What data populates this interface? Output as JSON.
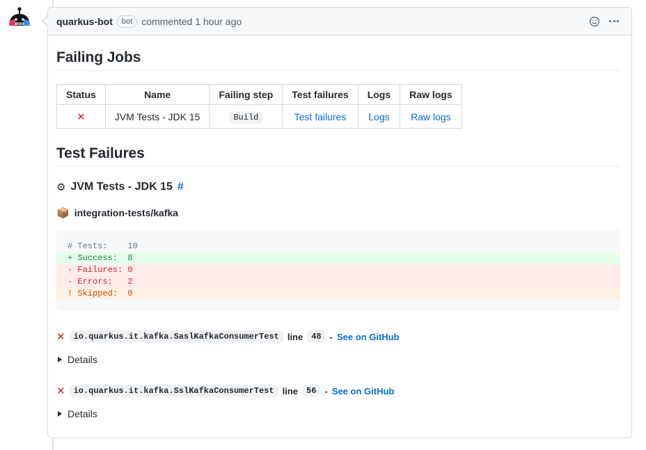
{
  "comment": {
    "author": "quarkus-bot",
    "bot_badge": "bot",
    "commented_text": "commented 1 hour ago",
    "reaction_icon": "smiley-icon",
    "menu_icon": "kebab-menu-icon",
    "avatar_icon": "quarkus-bot-avatar"
  },
  "failing_jobs": {
    "heading": "Failing Jobs",
    "columns": [
      "Status",
      "Name",
      "Failing step",
      "Test failures",
      "Logs",
      "Raw logs"
    ],
    "rows": [
      {
        "status_icon": "x-mark",
        "status_symbol": "✕",
        "name": "JVM Tests - JDK 15",
        "failing_step": "Build",
        "test_failures_link": "Test failures",
        "logs_link": "Logs",
        "raw_logs_link": "Raw logs"
      }
    ]
  },
  "test_failures": {
    "heading": "Test Failures",
    "job": {
      "icon": "⚙",
      "icon_name": "gear-emoji",
      "title": "JVM Tests - JDK 15",
      "anchor": "#"
    },
    "module": {
      "icon": "📦",
      "icon_name": "package-emoji",
      "name": "integration-tests/kafka"
    },
    "summary_block": [
      {
        "prefix": "#",
        "label": "Tests:",
        "value": "10",
        "style": "neutral"
      },
      {
        "prefix": "+",
        "label": "Success:",
        "value": "8",
        "style": "add"
      },
      {
        "prefix": "-",
        "label": "Failures:",
        "value": "0",
        "style": "del"
      },
      {
        "prefix": "-",
        "label": "Errors:",
        "value": "2",
        "style": "del"
      },
      {
        "prefix": "!",
        "label": "Skipped:",
        "value": "0",
        "style": "skip"
      }
    ],
    "summary_lines": [
      "# Tests:    10",
      "+ Success:  8",
      "- Failures: 0",
      "- Errors:   2",
      "! Skipped:  0"
    ],
    "failures": [
      {
        "status_symbol": "✕",
        "test_class": "io.quarkus.it.kafka.SaslKafkaConsumerTest",
        "line_label": "line",
        "line_number": "48",
        "separator": "-",
        "link_text": "See on GitHub",
        "details_label": "Details"
      },
      {
        "status_symbol": "✕",
        "test_class": "io.quarkus.it.kafka.SslKafkaConsumerTest",
        "line_label": "line",
        "line_number": "56",
        "separator": "-",
        "link_text": "See on GitHub",
        "details_label": "Details"
      }
    ]
  },
  "colors": {
    "link": "#0969da",
    "danger": "#cf222e",
    "success": "#1a7f37",
    "warning": "#bc4c00",
    "muted": "#57606a",
    "border": "#d0d7de",
    "header_bg": "#f6f8fa"
  }
}
